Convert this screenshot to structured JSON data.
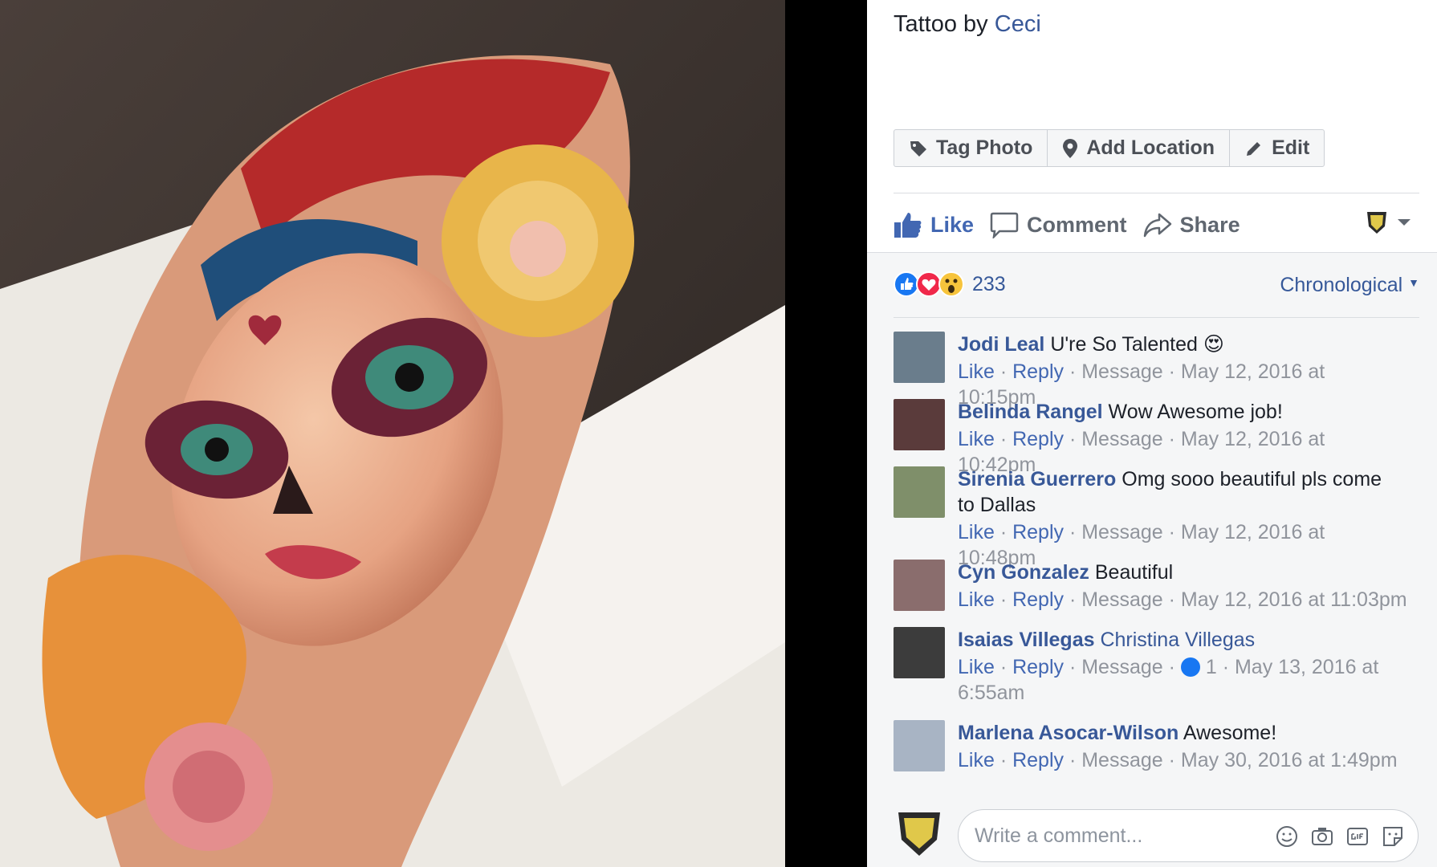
{
  "caption": {
    "prefix": "Tattoo by",
    "author": "Ceci"
  },
  "photo_actions": [
    {
      "label": "Tag Photo",
      "icon": "tag-icon"
    },
    {
      "label": "Add Location",
      "icon": "location-pin-icon"
    },
    {
      "label": "Edit",
      "icon": "pencil-icon"
    }
  ],
  "ufi": {
    "like": "Like",
    "comment": "Comment",
    "share": "Share"
  },
  "reactions": {
    "types": [
      "like",
      "love",
      "wow"
    ],
    "count": "233"
  },
  "sort": {
    "label": "Chronological"
  },
  "comments": [
    {
      "author": "Jodi Leal",
      "text": "U're So Talented 😍",
      "like": "Like",
      "reply": "Reply",
      "message": "Message",
      "date": "May 12, 2016 at 10:15pm",
      "reaction_count": "",
      "avatar_color": "#6a7d8c"
    },
    {
      "author": "Belinda Rangel",
      "text": "Wow Awesome job!",
      "like": "Like",
      "reply": "Reply",
      "message": "Message",
      "date": "May 12, 2016 at 10:42pm",
      "reaction_count": "",
      "avatar_color": "#5a3b3b"
    },
    {
      "author": "Sirenia Guerrero",
      "text": "Omg sooo beautiful pls come to Dallas",
      "like": "Like",
      "reply": "Reply",
      "message": "Message",
      "date": "May 12, 2016 at 10:48pm",
      "reaction_count": "",
      "avatar_color": "#7f8f6a"
    },
    {
      "author": "Cyn Gonzalez",
      "text": "Beautiful",
      "like": "Like",
      "reply": "Reply",
      "message": "Message",
      "date": "May 12, 2016 at 11:03pm",
      "reaction_count": "",
      "avatar_color": "#8a6d6d"
    },
    {
      "author": "Isaias Villegas",
      "text": "Christina Villegas",
      "like": "Like",
      "reply": "Reply",
      "message": "Message",
      "date": "May 13, 2016 at 6:55am",
      "reaction_count": "1",
      "avatar_color": "#3c3c3c"
    },
    {
      "author": "Marlena Asocar-Wilson",
      "text": "Awesome!",
      "like": "Like",
      "reply": "Reply",
      "message": "Message",
      "date": "May 30, 2016 at 1:49pm",
      "reaction_count": "",
      "avatar_color": "#a8b4c4"
    }
  ],
  "write_comment": {
    "placeholder": "Write a comment..."
  },
  "colors": {
    "fb_blue": "#4267b2",
    "link": "#385898",
    "muted": "#90949c",
    "panel_bg": "#f5f6f7"
  }
}
